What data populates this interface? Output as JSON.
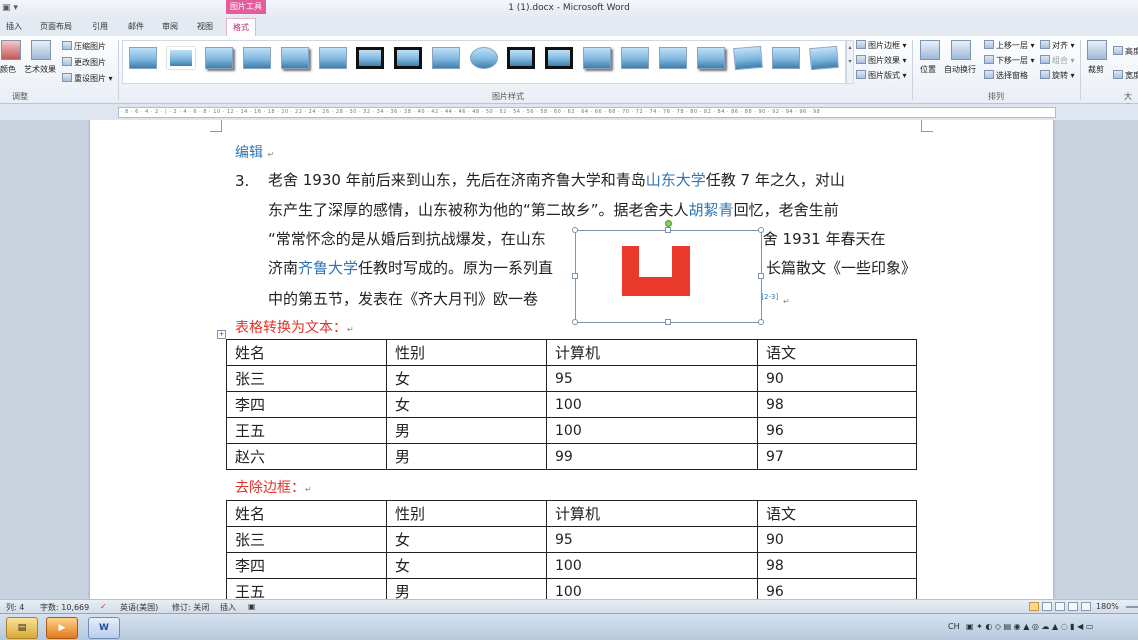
{
  "window": {
    "title": "1 (1).docx - Microsoft Word",
    "picture_tools_label": "图片工具"
  },
  "tabs": [
    {
      "label": "插入"
    },
    {
      "label": "页面布局"
    },
    {
      "label": "引用"
    },
    {
      "label": "邮件"
    },
    {
      "label": "审阅"
    },
    {
      "label": "视图"
    },
    {
      "label": "格式"
    }
  ],
  "ribbon": {
    "adjust": {
      "color_label": "颜色",
      "art_effects_label": "艺术效果",
      "compress_label": "压缩图片",
      "change_label": "更改图片",
      "reset_label": "重设图片",
      "group_label": "调整"
    },
    "styles": {
      "group_label": "图片样式",
      "border_label": "图片边框",
      "effects_label": "图片效果",
      "layout_label": "图片版式"
    },
    "arrange": {
      "position_label": "位置",
      "wrap_label": "自动换行",
      "forward_label": "上移一层",
      "backward_label": "下移一层",
      "selection_pane_label": "选择窗格",
      "align_label": "对齐",
      "group_btn_label": "组合",
      "rotate_label": "旋转",
      "group_label": "排列"
    },
    "size": {
      "crop_label": "裁剪",
      "height_label": "高度",
      "width_label": "宽度",
      "group_label": "大小"
    }
  },
  "document": {
    "heading_edit": "编辑",
    "para_number": "3.",
    "para_lines": [
      {
        "pre": "老舍 1930 年前后来到山东，先后在济南齐鲁大学和青岛",
        "link": "山东大学",
        "post": "任教 7 年之久，对山"
      },
      {
        "pre": "东产生了深厚的感情，山东被称为他的“第二故乡”。据老舍夫人",
        "link": "胡絜青",
        "post": "回忆，老舍生前"
      },
      {
        "pre": "“常常怀念的是从婚后到抗战爆发，在山东",
        "link": "",
        "post": "老舍 1931 年春天在"
      },
      {
        "pre": "济南",
        "link": "齐鲁大学",
        "post": "任教时写成的。原为一系列直"
      },
      {
        "pre": "中的第五节，发表在《齐大月刊》欧一卷",
        "link": "",
        "post": "）。"
      }
    ],
    "para_line3_right": "长篇散文《一些印象》",
    "footnote_ref": "[2-3]",
    "section1_title": "表格转换为文本：",
    "section2_title": "去除边框：",
    "table1": {
      "headers": [
        "姓名",
        "性别",
        "计算机",
        "语文"
      ],
      "rows": [
        [
          "张三",
          "女",
          "95",
          "90"
        ],
        [
          "李四",
          "女",
          "100",
          "98"
        ],
        [
          "王五",
          "男",
          "100",
          "96"
        ],
        [
          "赵六",
          "男",
          "99",
          "97"
        ]
      ]
    },
    "table2": {
      "headers": [
        "姓名",
        "性别",
        "计算机",
        "语文"
      ],
      "rows": [
        [
          "张三",
          "女",
          "95",
          "90"
        ],
        [
          "李四",
          "女",
          "100",
          "98"
        ],
        [
          "王五",
          "男",
          "100",
          "96"
        ]
      ]
    },
    "picture_color": "#e8392b"
  },
  "statusbar": {
    "column": "列: 4",
    "word_count": "字数: 10,669",
    "language": "英语(美国)",
    "track_changes": "修订: 关闭",
    "insert_mode": "插入",
    "zoom": "180%"
  },
  "taskbar": {
    "word_label": "W",
    "tray_text": "CH"
  }
}
